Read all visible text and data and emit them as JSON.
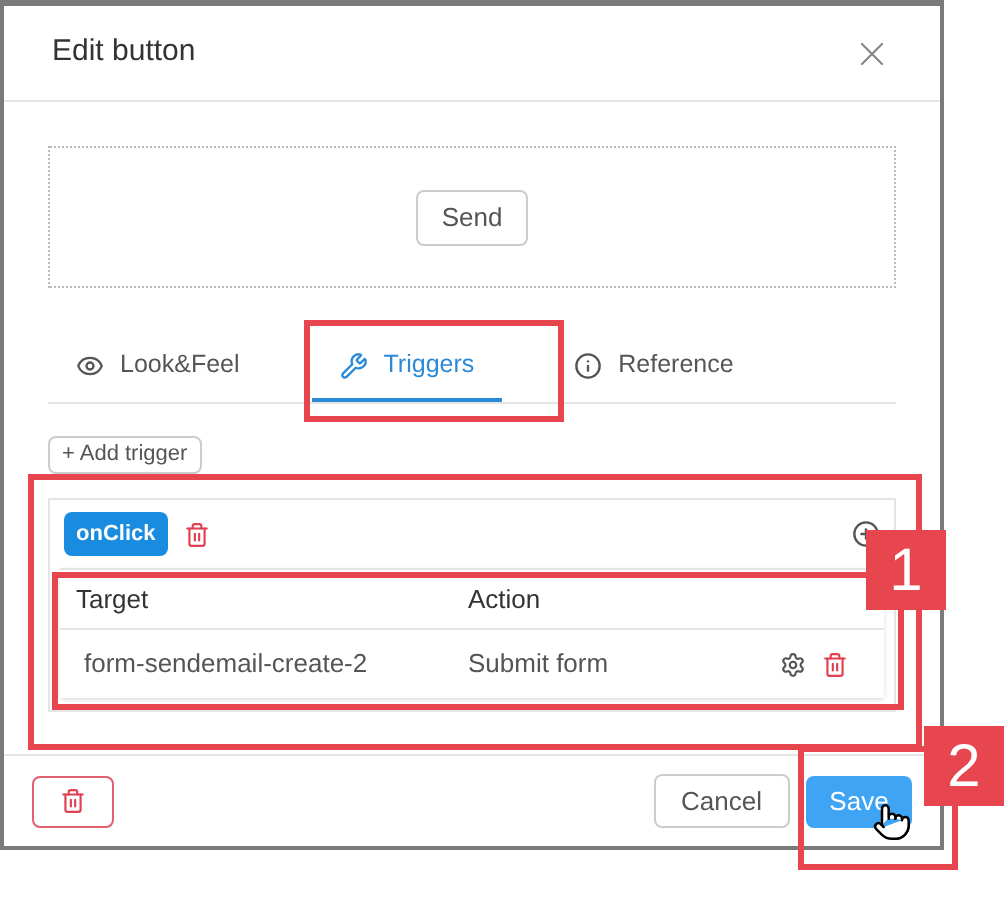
{
  "dialog": {
    "title": "Edit button",
    "preview_button": "Send"
  },
  "tabs": [
    {
      "label": "Look&Feel",
      "selected": false
    },
    {
      "label": "Triggers",
      "selected": true
    },
    {
      "label": "Reference",
      "selected": false
    }
  ],
  "add_trigger": "+ Add trigger",
  "triggers": [
    {
      "event": "onClick",
      "columns": [
        "Target",
        "Action"
      ],
      "rows": [
        {
          "target": "form-sendemail-create-2",
          "action": "Submit form"
        }
      ]
    }
  ],
  "footer": {
    "cancel": "Cancel",
    "save": "Save"
  },
  "callouts": [
    "1",
    "2"
  ]
}
